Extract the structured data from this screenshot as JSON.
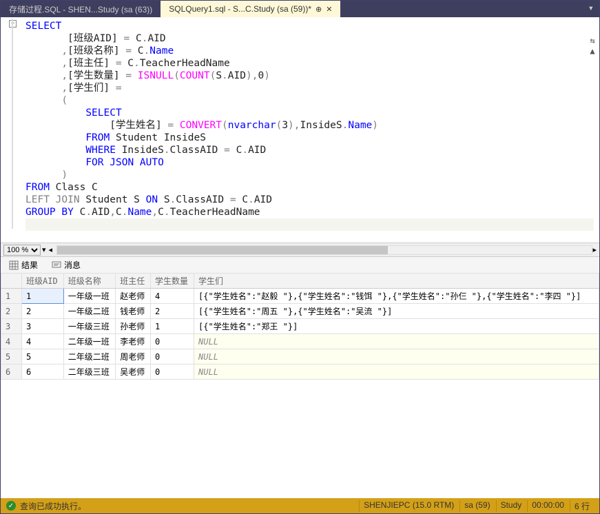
{
  "tabs": [
    {
      "label": "存储过程.SQL - SHEN...Study (sa (63))",
      "active": false
    },
    {
      "label": "SQLQuery1.sql - S...C.Study (sa (59))*",
      "active": true
    }
  ],
  "editor": {
    "lines_html": "<span class='kw'>SELECT</span>\n       <span class='id'>[班级AID]</span> <span class='gray'>=</span> <span class='id'>C</span><span class='gray'>.</span><span class='id'>AID</span>\n      <span class='gray'>,</span><span class='id'>[班级名称]</span> <span class='gray'>=</span> <span class='id'>C</span><span class='gray'>.</span><span class='kw'>Name</span>\n      <span class='gray'>,</span><span class='id'>[班主任]</span> <span class='gray'>=</span> <span class='id'>C</span><span class='gray'>.</span><span class='id'>TeacherHeadName</span>\n      <span class='gray'>,</span><span class='id'>[学生数量]</span> <span class='gray'>=</span> <span class='fn'>ISNULL</span><span class='gray'>(</span><span class='fn'>COUNT</span><span class='gray'>(</span><span class='id'>S</span><span class='gray'>.</span><span class='id'>AID</span><span class='gray'>),</span><span class='num'>0</span><span class='gray'>)</span>\n      <span class='gray'>,</span><span class='id'>[学生们]</span> <span class='gray'>=</span> \n      <span class='gray'>(</span>\n          <span class='kw'>SELECT</span>\n              <span class='id'>[学生姓名]</span> <span class='gray'>=</span> <span class='fn'>CONVERT</span><span class='gray'>(</span><span class='kw'>nvarchar</span><span class='gray'>(</span><span class='num'>3</span><span class='gray'>),</span><span class='id'>InsideS</span><span class='gray'>.</span><span class='kw'>Name</span><span class='gray'>)</span>\n          <span class='kw'>FROM</span> <span class='id'>Student</span> <span class='id'>InsideS</span>\n          <span class='kw'>WHERE</span> <span class='id'>InsideS</span><span class='gray'>.</span><span class='id'>ClassAID</span> <span class='gray'>=</span> <span class='id'>C</span><span class='gray'>.</span><span class='id'>AID</span>\n          <span class='kw'>FOR</span> <span class='kw'>JSON</span> <span class='kw'>AUTO</span>\n      <span class='gray'>)</span>\n<span class='kw'>FROM</span> <span class='id'>Class</span> <span class='id'>C</span>\n<span class='gray'>LEFT</span> <span class='gray'>JOIN</span> <span class='id'>Student</span> <span class='id'>S</span> <span class='kw'>ON</span> <span class='id'>S</span><span class='gray'>.</span><span class='id'>ClassAID</span> <span class='gray'>=</span> <span class='id'>C</span><span class='gray'>.</span><span class='id'>AID</span>\n<span class='kw'>GROUP</span> <span class='kw'>BY</span> <span class='id'>C</span><span class='gray'>.</span><span class='id'>AID</span><span class='gray'>,</span><span class='id'>C</span><span class='gray'>.</span><span class='kw'>Name</span><span class='gray'>,</span><span class='id'>C</span><span class='gray'>.</span><span class='id'>TeacherHeadName</span>"
  },
  "zoom": "100 %",
  "results_tabs": {
    "results": "结果",
    "messages": "消息"
  },
  "grid": {
    "headers": [
      "",
      "班级AID",
      "班级名称",
      "班主任",
      "学生数量",
      "学生们"
    ],
    "rows": [
      [
        "1",
        "1",
        "一年级一班",
        "赵老师",
        "4",
        "[{\"学生姓名\":\"赵毅 \"},{\"学生姓名\":\"钱饵 \"},{\"学生姓名\":\"孙仨 \"},{\"学生姓名\":\"李四 \"}]"
      ],
      [
        "2",
        "2",
        "一年级二班",
        "钱老师",
        "2",
        "[{\"学生姓名\":\"周五 \"},{\"学生姓名\":\"吴流 \"}]"
      ],
      [
        "3",
        "3",
        "一年级三班",
        "孙老师",
        "1",
        "[{\"学生姓名\":\"郑王 \"}]"
      ],
      [
        "4",
        "4",
        "二年级一班",
        "李老师",
        "0",
        "NULL"
      ],
      [
        "5",
        "5",
        "二年级二班",
        "周老师",
        "0",
        "NULL"
      ],
      [
        "6",
        "6",
        "二年级三班",
        "吴老师",
        "0",
        "NULL"
      ]
    ]
  },
  "status": {
    "message": "查询已成功执行。",
    "server": "SHENJIEPC (15.0 RTM)",
    "user": "sa (59)",
    "db": "Study",
    "time": "00:00:00",
    "rows": "6 行"
  }
}
